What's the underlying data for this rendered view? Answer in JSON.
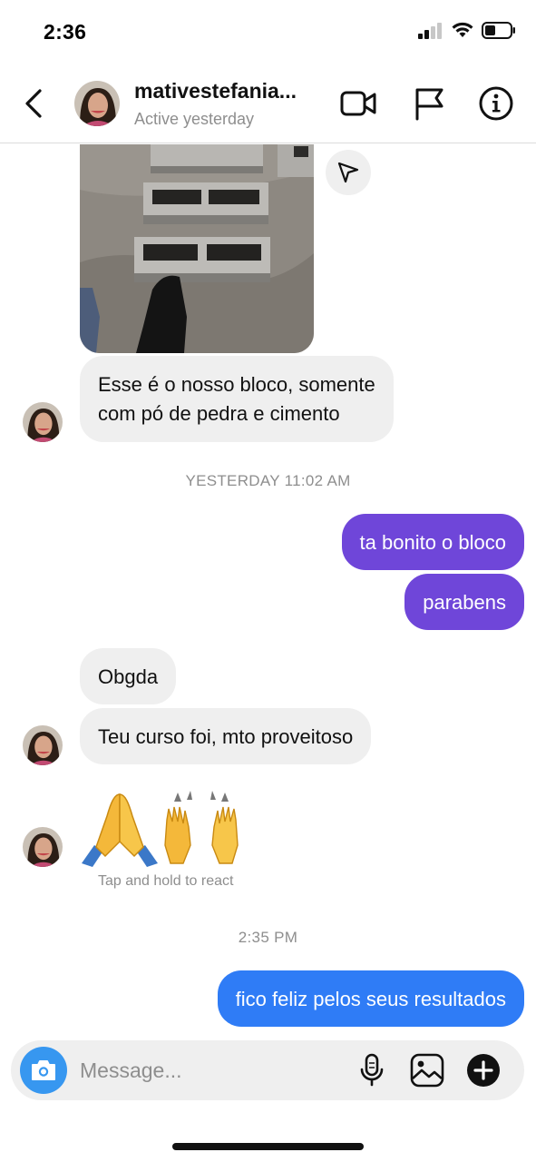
{
  "status_bar": {
    "time": "2:36"
  },
  "header": {
    "contact_name": "mativestefania...",
    "contact_status": "Active yesterday"
  },
  "messages": {
    "incoming_1": {
      "line1": "Esse é o nosso bloco, somente",
      "line2": "com pó de pedra e cimento"
    },
    "timestamp_1": "YESTERDAY 11:02 AM",
    "outgoing_1": "ta bonito o bloco",
    "outgoing_2": "parabens",
    "incoming_2": "Obgda",
    "incoming_3": "Teu curso foi, mto proveitoso",
    "emoji_message": "🙏🙌",
    "react_hint": "Tap and hold to react",
    "timestamp_2": "2:35 PM",
    "outgoing_3": "fico feliz pelos seus resultados"
  },
  "composer": {
    "placeholder": "Message..."
  },
  "colors": {
    "outgoing_purple": "#6f46d9",
    "outgoing_blue": "#2f7cf6",
    "incoming_bg": "#efefef",
    "camera_blue": "#3797f0"
  },
  "icons": {
    "back": "chevron-left-icon",
    "video": "video-camera-icon",
    "flag": "flag-icon",
    "info": "info-icon",
    "share": "send-icon",
    "camera": "camera-icon",
    "mic": "microphone-icon",
    "gallery": "gallery-icon",
    "add": "plus-circle-icon"
  }
}
